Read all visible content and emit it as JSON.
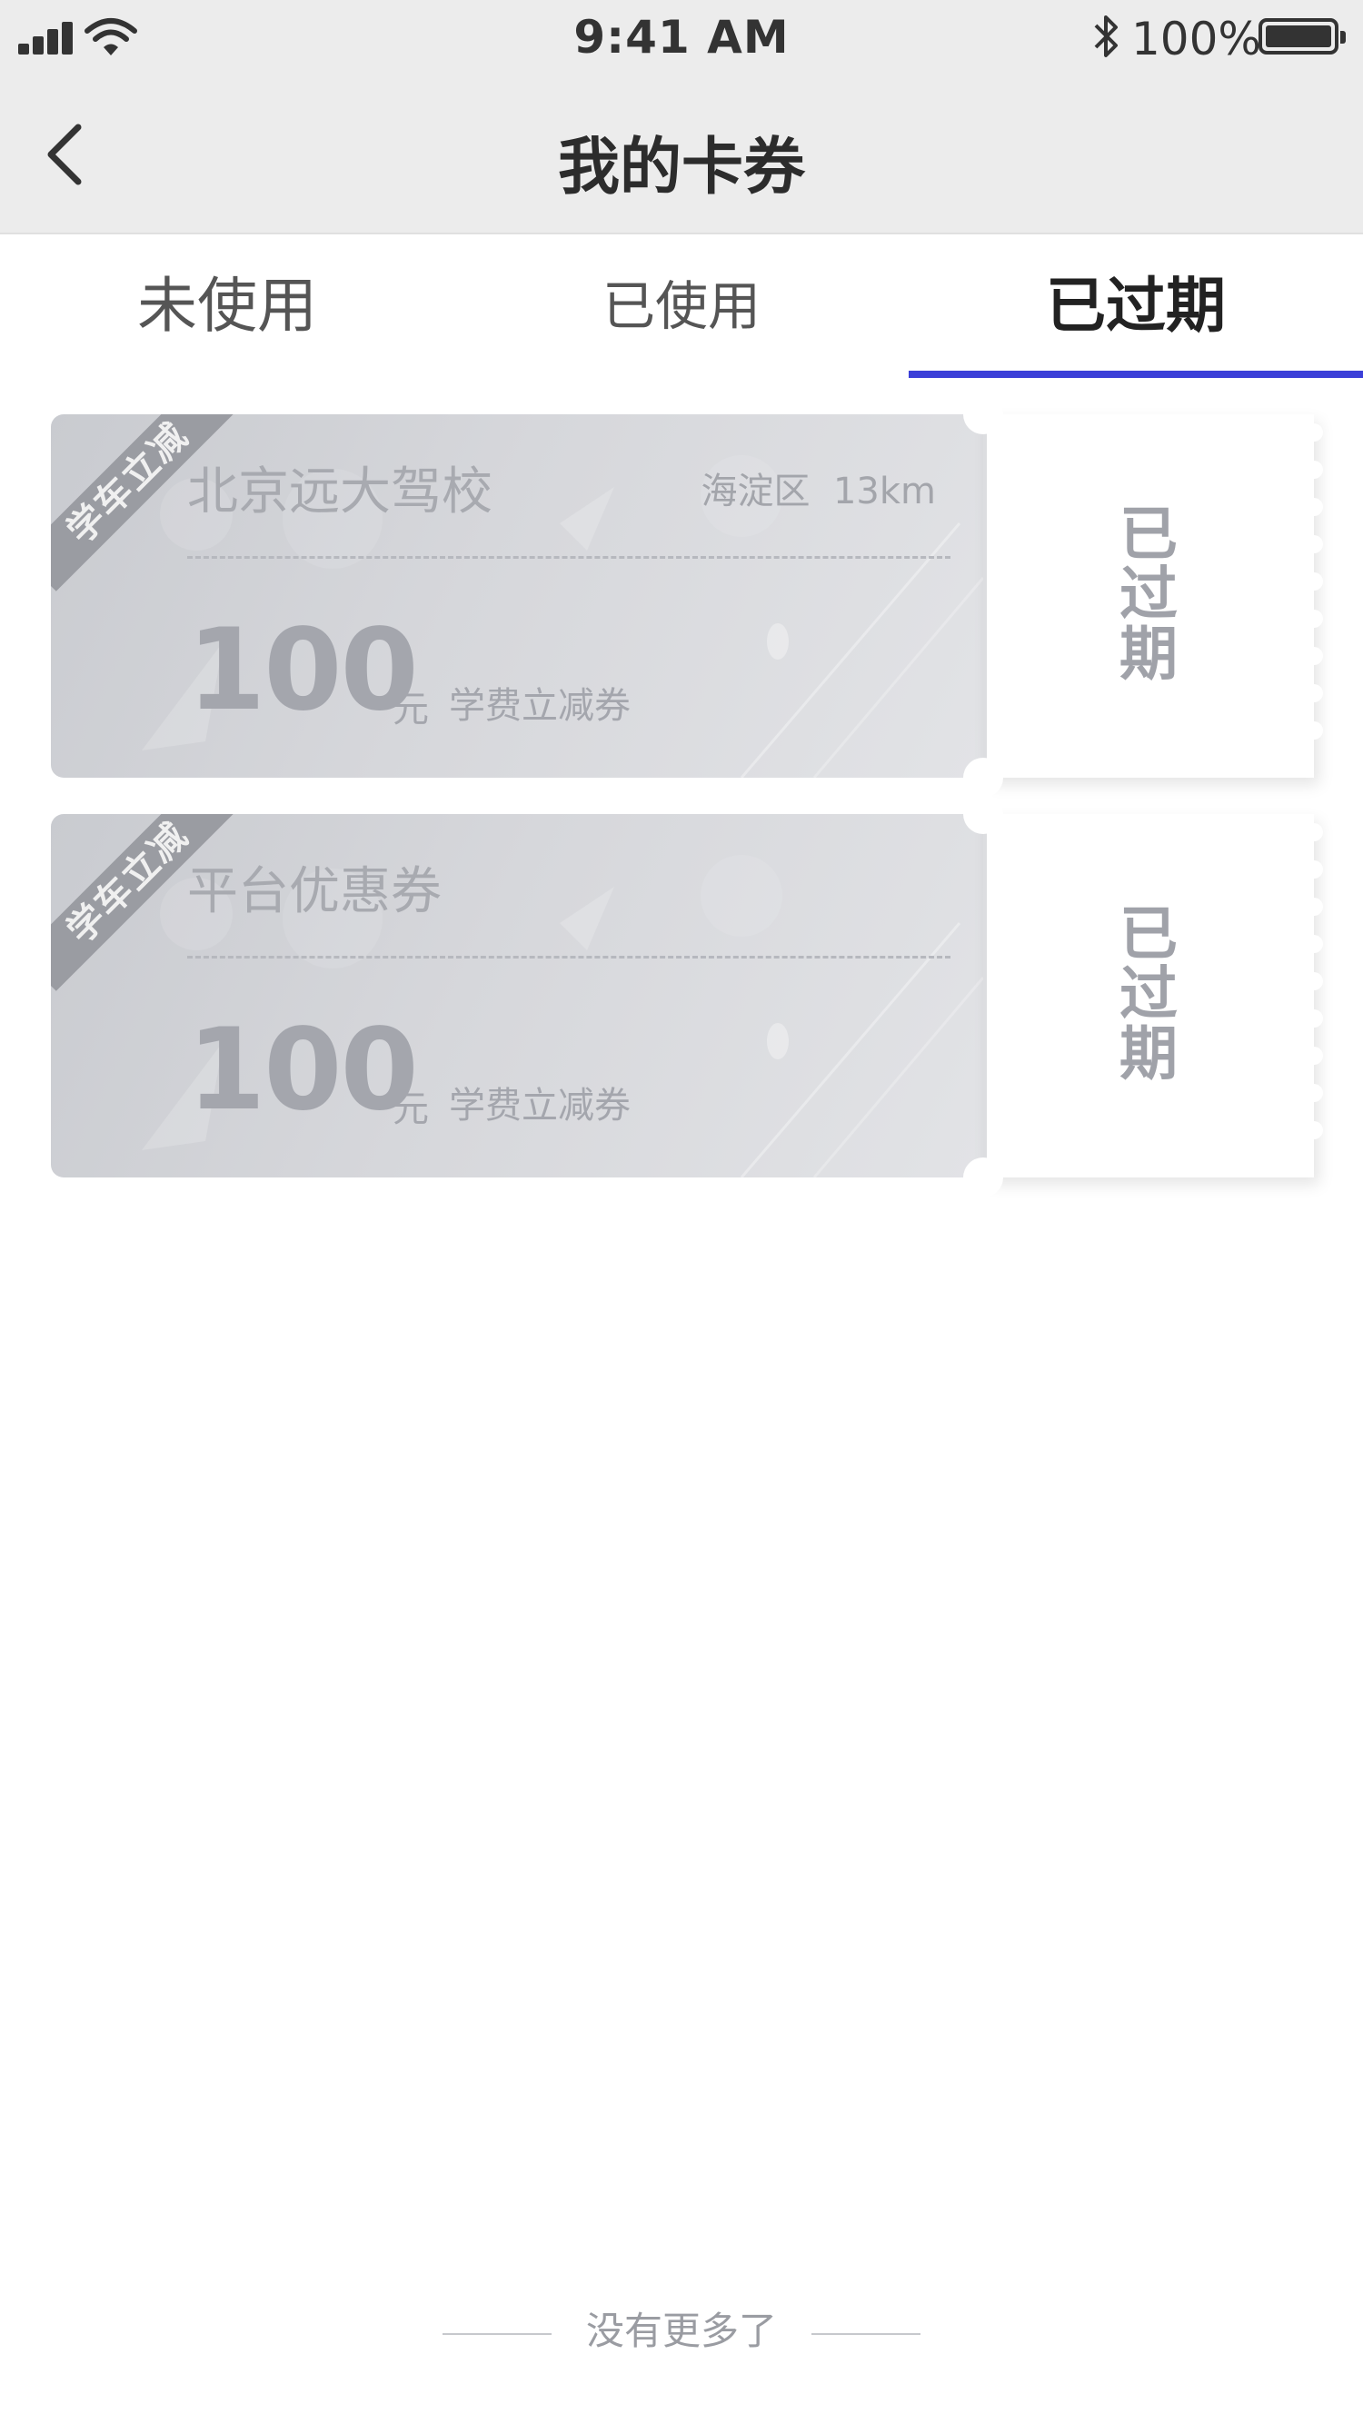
{
  "status_bar": {
    "time": "9:41 AM",
    "battery": "100%"
  },
  "nav": {
    "title": "我的卡券"
  },
  "tabs": [
    {
      "label": "未使用",
      "active": false
    },
    {
      "label": "已使用",
      "active": false
    },
    {
      "label": "已过期",
      "active": true
    }
  ],
  "accent_color": "#3b3fd8",
  "coupons": [
    {
      "ribbon": "学车立减",
      "name": "北京远大驾校",
      "district": "海淀区",
      "distance": "13km",
      "amount": "100",
      "unit": "元",
      "type": "学费立减券",
      "status": "已过期"
    },
    {
      "ribbon": "学车立减",
      "name": "平台优惠券",
      "amount": "100",
      "unit": "元",
      "type": "学费立减券",
      "status": "已过期"
    }
  ],
  "footer": {
    "no_more": "没有更多了"
  }
}
